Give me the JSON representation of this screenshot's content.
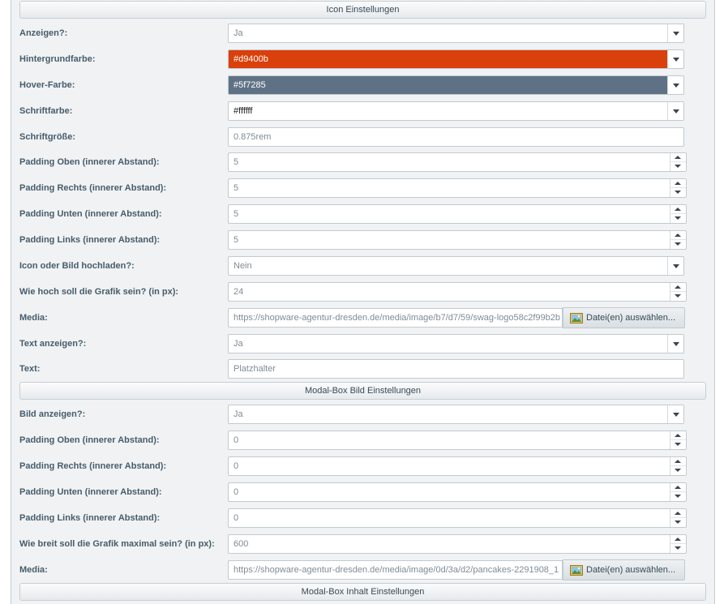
{
  "sections": {
    "icon": "Icon Einstellungen",
    "modal_image": "Modal-Box Bild Einstellungen",
    "modal_content": "Modal-Box Inhalt Einstellungen"
  },
  "icon_fields": {
    "show_label": "Anzeigen?:",
    "show_value": "Ja",
    "bg_label": "Hintergrundfarbe:",
    "bg_value": "#d9400b",
    "hover_label": "Hover-Farbe:",
    "hover_value": "#5f7285",
    "fontcolor_label": "Schriftfarbe:",
    "fontcolor_value": "#ffffff",
    "fontsize_label": "Schriftgröße:",
    "fontsize_value": "0.875rem",
    "pad_top_label": "Padding Oben (innerer Abstand):",
    "pad_top_value": "5",
    "pad_right_label": "Padding Rechts (innerer Abstand):",
    "pad_right_value": "5",
    "pad_bottom_label": "Padding Unten (innerer Abstand):",
    "pad_bottom_value": "5",
    "pad_left_label": "Padding Links (innerer Abstand):",
    "pad_left_value": "5",
    "upload_label": "Icon oder Bild hochladen?:",
    "upload_value": "Nein",
    "height_label": "Wie hoch soll die Grafik sein? (in px):",
    "height_value": "24",
    "media_label": "Media:",
    "media_value": "https://shopware-agentur-dresden.de/media/image/b7/d7/59/swag-logo58c2f99b2b",
    "media_button": "Datei(en) auswählen...",
    "showtext_label": "Text anzeigen?:",
    "showtext_value": "Ja",
    "text_label": "Text:",
    "text_value": "Platzhalter"
  },
  "modal_fields": {
    "showimg_label": "Bild anzeigen?:",
    "showimg_value": "Ja",
    "pad_top_label": "Padding Oben (innerer Abstand):",
    "pad_top_value": "0",
    "pad_right_label": "Padding Rechts (innerer Abstand):",
    "pad_right_value": "0",
    "pad_bottom_label": "Padding Unten (innerer Abstand):",
    "pad_bottom_value": "0",
    "pad_left_label": "Padding Links (innerer Abstand):",
    "pad_left_value": "0",
    "maxwidth_label": "Wie breit soll die Grafik maximal sein? (in px):",
    "maxwidth_value": "600",
    "media_label": "Media:",
    "media_value": "https://shopware-agentur-dresden.de/media/image/0d/3a/d2/pancakes-2291908_1",
    "media_button": "Datei(en) auswählen..."
  },
  "colors": {
    "background_swatch": "#d9400b",
    "hover_swatch": "#5f7285",
    "swatch_text": "#ffffff"
  }
}
